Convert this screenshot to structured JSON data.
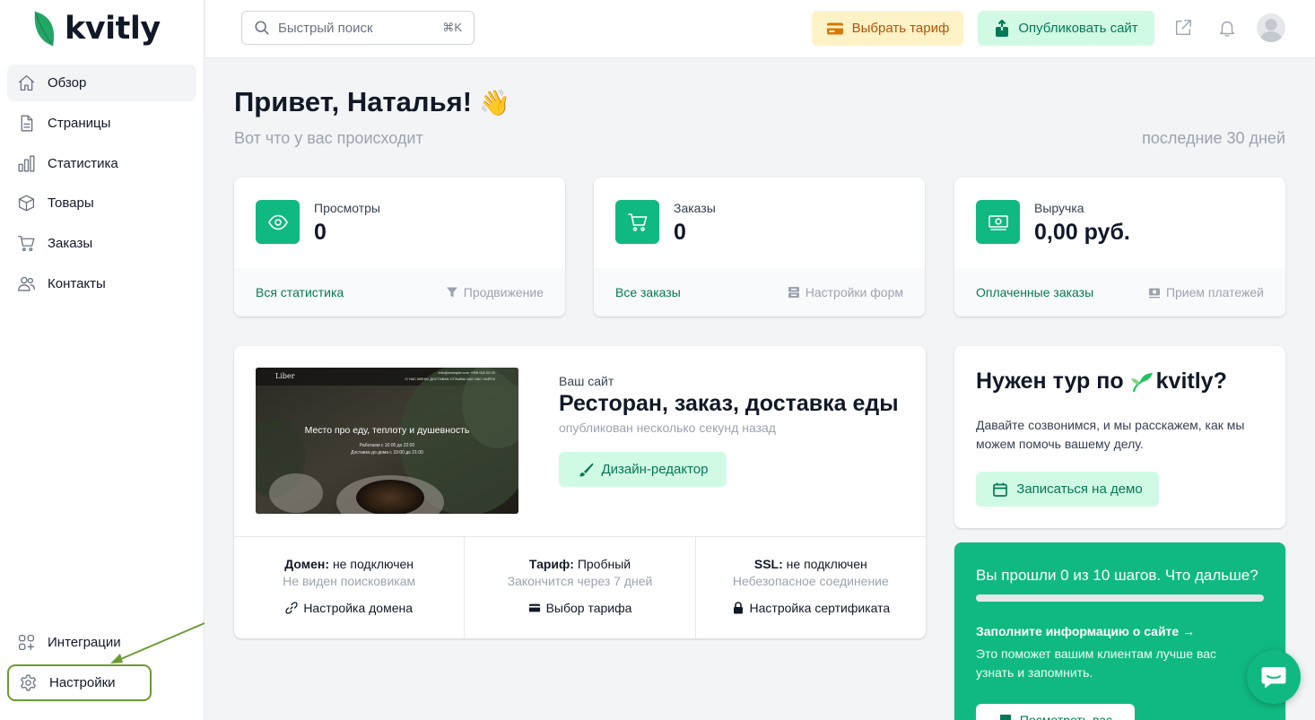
{
  "brand": {
    "name": "kvitly",
    "accent": "#10b981"
  },
  "sidebar": {
    "items": [
      {
        "label": "Обзор",
        "icon": "home-icon",
        "active": true
      },
      {
        "label": "Страницы",
        "icon": "document-icon"
      },
      {
        "label": "Статистика",
        "icon": "bar-chart-icon"
      },
      {
        "label": "Товары",
        "icon": "cube-icon"
      },
      {
        "label": "Заказы",
        "icon": "cart-icon"
      },
      {
        "label": "Контакты",
        "icon": "users-icon"
      }
    ],
    "bottom": [
      {
        "label": "Интеграции",
        "icon": "integrations-icon"
      },
      {
        "label": "Настройки",
        "icon": "gear-icon",
        "highlighted": true
      }
    ]
  },
  "topbar": {
    "search_placeholder": "Быстрый поиск",
    "search_shortcut": "⌘K",
    "tariff_label": "Выбрать тариф",
    "publish_label": "Опубликовать сайт"
  },
  "main": {
    "greeting": "Привет, Наталья!",
    "greeting_emoji": "👋",
    "subtitle": "Вот что у вас происходит",
    "period": "последние 30 дней"
  },
  "stats": [
    {
      "label": "Просмотры",
      "value": "0",
      "link": "Вся статистика",
      "aux": "Продвижение",
      "icon": "eye-icon",
      "aux_icon": "filter-icon"
    },
    {
      "label": "Заказы",
      "value": "0",
      "link": "Все заказы",
      "aux": "Настройки форм",
      "icon": "cart-icon",
      "aux_icon": "inbox-stack-icon"
    },
    {
      "label": "Выручка",
      "value": "0,00 руб.",
      "link": "Оплаченные заказы",
      "aux": "Прием платежей",
      "icon": "banknote-icon",
      "aux_icon": "payment-icon"
    }
  ],
  "site": {
    "caption": "Ваш сайт",
    "title": "Ресторан, заказ, доставка еды",
    "published": "опубликован несколько секунд назад",
    "design_button": "Дизайн-редактор",
    "preview": {
      "logo": "Liber",
      "contact": "info@example.com   +998 000 00 00",
      "nav": "О НАС   МЕНЮ   ДОСТАВКА   ОТЗЫВЫ   КАК НАС НАЙТИ",
      "headline": "Место про еду, теплоту и душевность",
      "line1": "Работаем с 10:00 до 22:00",
      "line2": "Доставка до дома с 10:00 до 21:00"
    },
    "info": [
      {
        "key": "Домен:",
        "value": " не подключен",
        "desc": "Не виден поисковикам",
        "action": "Настройка домена",
        "icon": "link-icon"
      },
      {
        "key": "Тариф:",
        "value": " Пробный",
        "desc": "Закончится через 7 дней",
        "action": "Выбор тарифа",
        "icon": "credit-card-icon"
      },
      {
        "key": "SSL:",
        "value": " не подключен",
        "desc": "Небезопасное соединение",
        "action": "Настройка сертификата",
        "icon": "lock-icon"
      }
    ]
  },
  "tour": {
    "title_prefix": "Нужен тур по",
    "title_brand": "kvitly?",
    "desc": "Давайте созвонимся, и мы расскажем, как мы можем помочь вашему делу.",
    "button": "Записаться на демо"
  },
  "steps": {
    "title": "Вы прошли 0 из 10 шагов. Что дальше?",
    "progress": 0,
    "next": "Заполните информацию о сайте →",
    "next_desc": "Это поможет вашим клиентам лучше вас узнать и запомнить.",
    "button": "Посмотреть вас"
  }
}
